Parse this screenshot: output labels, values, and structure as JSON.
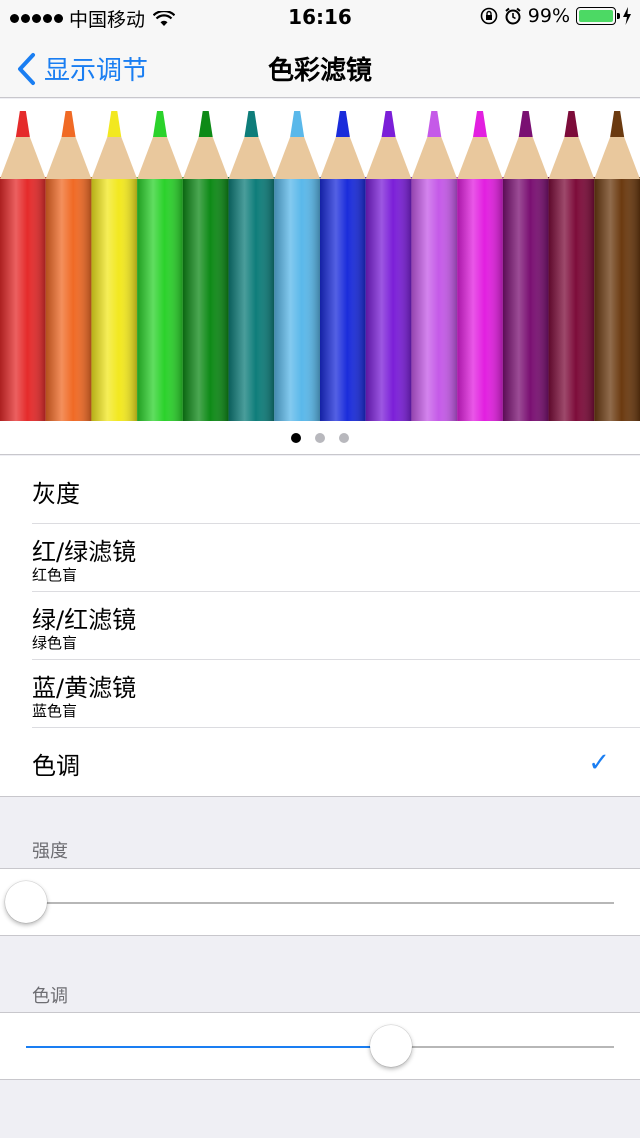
{
  "status_bar": {
    "carrier": "中国移动",
    "time": "16:16",
    "battery_percent": "99%",
    "icons": [
      "signal-dots-icon",
      "wifi-icon",
      "orientation-lock-icon",
      "alarm-icon",
      "battery-icon",
      "charging-bolt-icon"
    ]
  },
  "nav": {
    "back_label": "显示调节",
    "title": "色彩滤镜"
  },
  "banner": {
    "image": "colored-pencils",
    "pencil_colors": [
      "#e52b2b",
      "#f06a25",
      "#f2e820",
      "#2bd22b",
      "#0e8a17",
      "#0e7d7a",
      "#5ab8ea",
      "#1a2cdb",
      "#7b1fd8",
      "#c55ae8",
      "#e21fe0",
      "#7a1072",
      "#7d0c3a",
      "#6b3a10"
    ],
    "page_count": 3,
    "current_page": 0
  },
  "filters": [
    {
      "title": "灰度",
      "subtitle": "",
      "selected": false
    },
    {
      "title": "红/绿滤镜",
      "subtitle": "红色盲",
      "selected": false
    },
    {
      "title": "绿/红滤镜",
      "subtitle": "绿色盲",
      "selected": false
    },
    {
      "title": "蓝/黄滤镜",
      "subtitle": "蓝色盲",
      "selected": false
    },
    {
      "title": "色调",
      "subtitle": "",
      "selected": true
    }
  ],
  "intensity": {
    "label": "强度",
    "value": 0.0
  },
  "hue": {
    "label": "色调",
    "value": 0.62
  },
  "colors": {
    "accent": "#1a7ef2",
    "background": "#efeff4",
    "battery": "#4cd964"
  }
}
